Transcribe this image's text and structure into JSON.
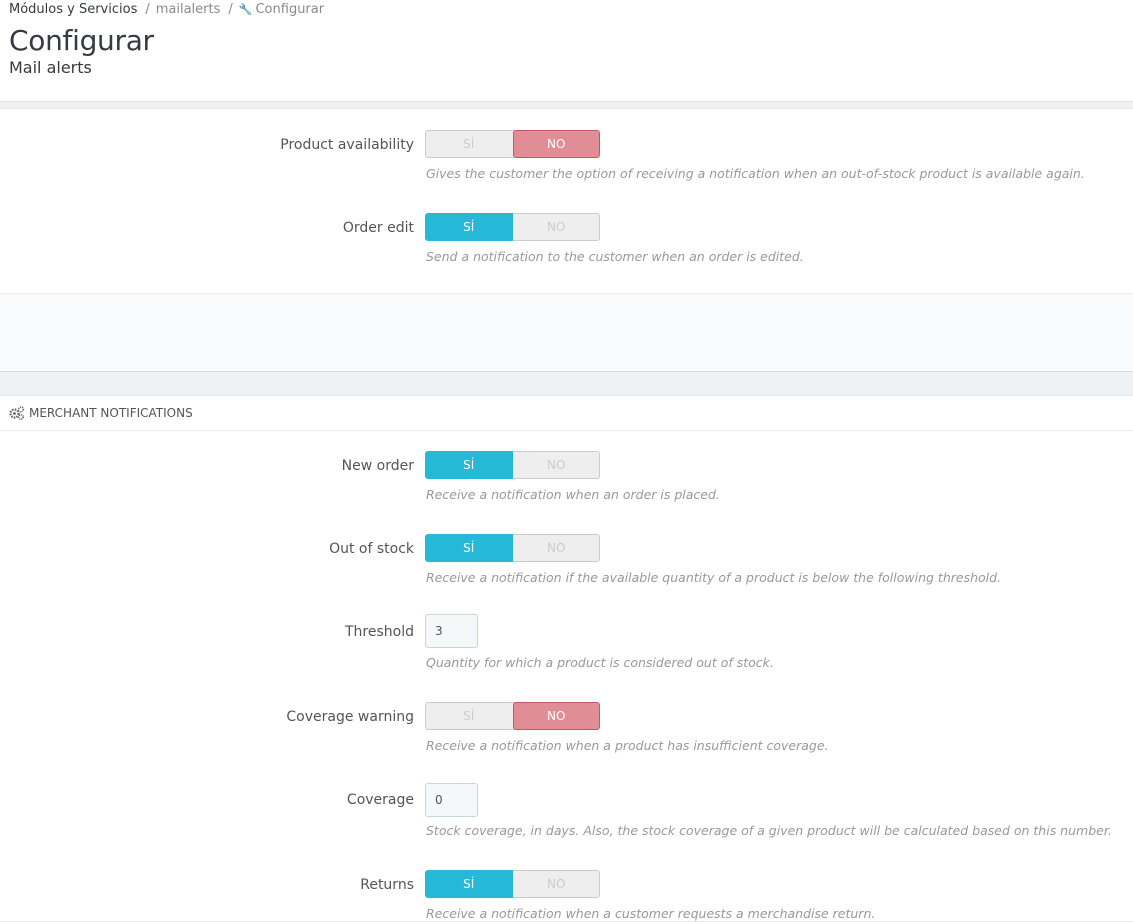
{
  "breadcrumb": {
    "item1": "Módulos y Servicios",
    "item2": "mailalerts",
    "item3": "Configurar",
    "separator": "/"
  },
  "header": {
    "title": "Configurar",
    "subtitle": "Mail alerts"
  },
  "customer": {
    "product_availability": {
      "label": "Product availability",
      "yes": "SÍ",
      "no": "NO",
      "value": "no",
      "help": "Gives the customer the option of receiving a notification when an out-of-stock product is available again."
    },
    "order_edit": {
      "label": "Order edit",
      "yes": "SÍ",
      "no": "NO",
      "value": "yes",
      "help": "Send a notification to the customer when an order is edited."
    }
  },
  "merchant": {
    "heading": "MERCHANT NOTIFICATIONS",
    "new_order": {
      "label": "New order",
      "yes": "SÍ",
      "no": "NO",
      "value": "yes",
      "help": "Receive a notification when an order is placed."
    },
    "out_of_stock": {
      "label": "Out of stock",
      "yes": "SÍ",
      "no": "NO",
      "value": "yes",
      "help": "Receive a notification if the available quantity of a product is below the following threshold."
    },
    "threshold": {
      "label": "Threshold",
      "value": "3",
      "help": "Quantity for which a product is considered out of stock."
    },
    "coverage_warning": {
      "label": "Coverage warning",
      "yes": "SÍ",
      "no": "NO",
      "value": "no",
      "help": "Receive a notification when a product has insufficient coverage."
    },
    "coverage": {
      "label": "Coverage",
      "value": "0",
      "help": "Stock coverage, in days. Also, the stock coverage of a given product will be calculated based on this number."
    },
    "returns": {
      "label": "Returns",
      "yes": "SÍ",
      "no": "NO",
      "value": "yes",
      "help": "Receive a notification when a customer requests a merchandise return."
    }
  },
  "colors": {
    "accent": "#25b9d7",
    "no_active": "#e08d95"
  },
  "icons": {
    "breadcrumb_tool": "wrench-icon",
    "merchant_heading": "cogs-icon"
  }
}
